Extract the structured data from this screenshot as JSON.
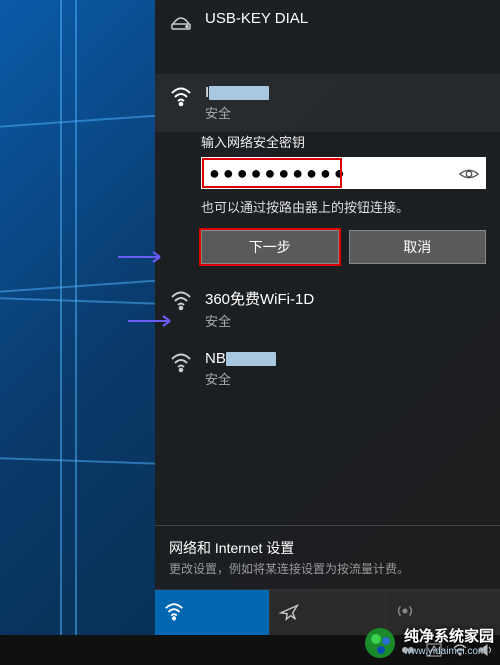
{
  "networks": {
    "dial": {
      "name": "USB-KEY DIAL"
    },
    "current": {
      "name": "I",
      "sub": "安全"
    },
    "n2": {
      "name": "360免费WiFi-1D",
      "sub": "安全"
    },
    "n3": {
      "name": "NB",
      "sub": "安全"
    }
  },
  "connect": {
    "prompt": "输入网络安全密钥",
    "password_masked": "●●●●●●●●●●",
    "hint": "也可以通过按路由器上的按钮连接。",
    "next": "下一步",
    "cancel": "取消"
  },
  "settings": {
    "title": "网络和 Internet 设置",
    "sub": "更改设置，例如将某连接设置为按流量计费。"
  },
  "tiles": {
    "wlan": "WLAN",
    "airplane": "飞行模式",
    "hotspot": "移动热点"
  },
  "watermark": {
    "main": "纯净系统家园",
    "sub": "www.yidaimei.com"
  }
}
